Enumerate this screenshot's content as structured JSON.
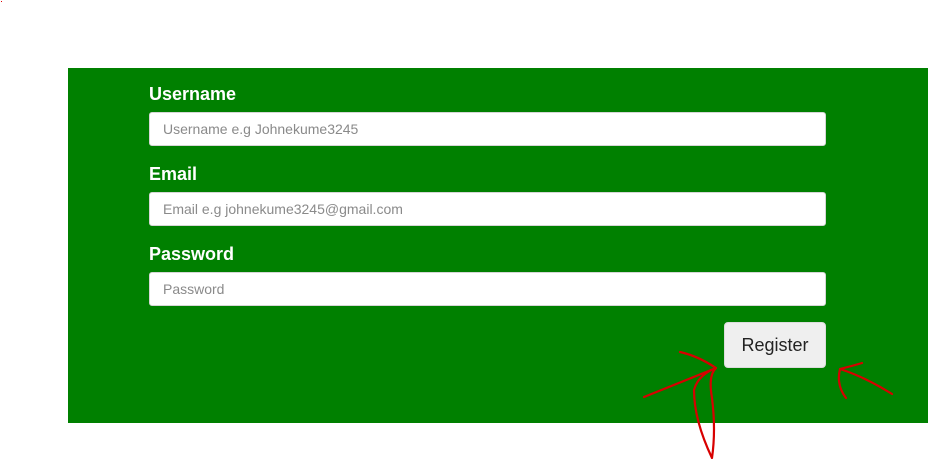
{
  "form": {
    "username": {
      "label": "Username",
      "placeholder": "Username e.g Johnekume3245"
    },
    "email": {
      "label": "Email",
      "placeholder": "Email e.g johnekume3245@gmail.com"
    },
    "password": {
      "label": "Password",
      "placeholder": "Password"
    },
    "register_label": "Register"
  },
  "colors": {
    "panel_background": "#008000",
    "annotation_stroke": "#d80000",
    "button_background": "#efefef"
  }
}
